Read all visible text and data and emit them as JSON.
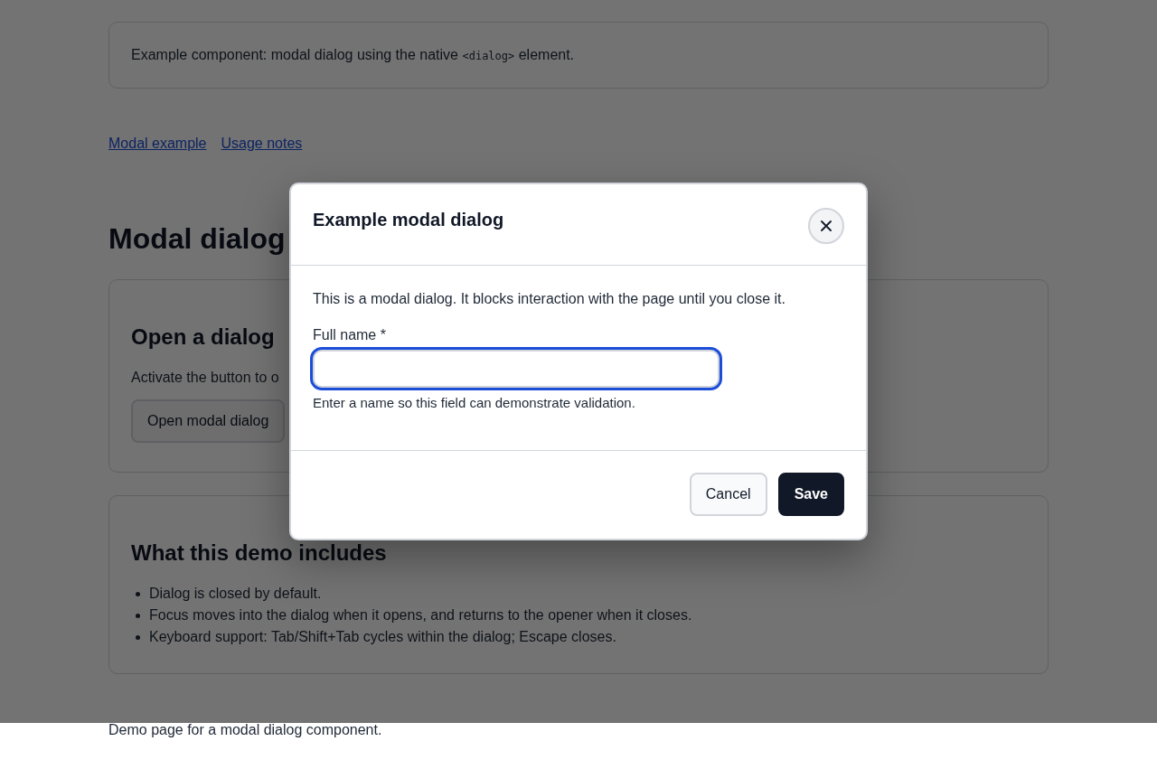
{
  "intro": {
    "text_before": "Example component: modal dialog using the native",
    "code": "<dialog>",
    "text_after": "element."
  },
  "links": [
    {
      "label": "Modal example"
    },
    {
      "label": "Usage notes"
    }
  ],
  "heading": "Modal dialog",
  "open_card": {
    "title": "Open a dialog",
    "text": "Activate the button to o",
    "button": "Open modal dialog"
  },
  "demo_card": {
    "title": "What this demo includes",
    "items": [
      "Dialog is closed by default.",
      "Focus moves into the dialog when it opens, and returns to the opener when it closes.",
      "Keyboard support: Tab/Shift+Tab cycles within the dialog; Escape closes."
    ]
  },
  "footer": "Demo page for a modal dialog component.",
  "dialog": {
    "title": "Example modal dialog",
    "description": "This is a modal dialog. It blocks interaction with the page until you close it.",
    "field": {
      "label": "Full name *",
      "focused": true,
      "hint": "Enter a name so this field can demonstrate validation."
    },
    "buttons": [
      {
        "label": "Cancel",
        "kind": "secondary"
      },
      {
        "label": "Save",
        "kind": "primary"
      }
    ]
  }
}
